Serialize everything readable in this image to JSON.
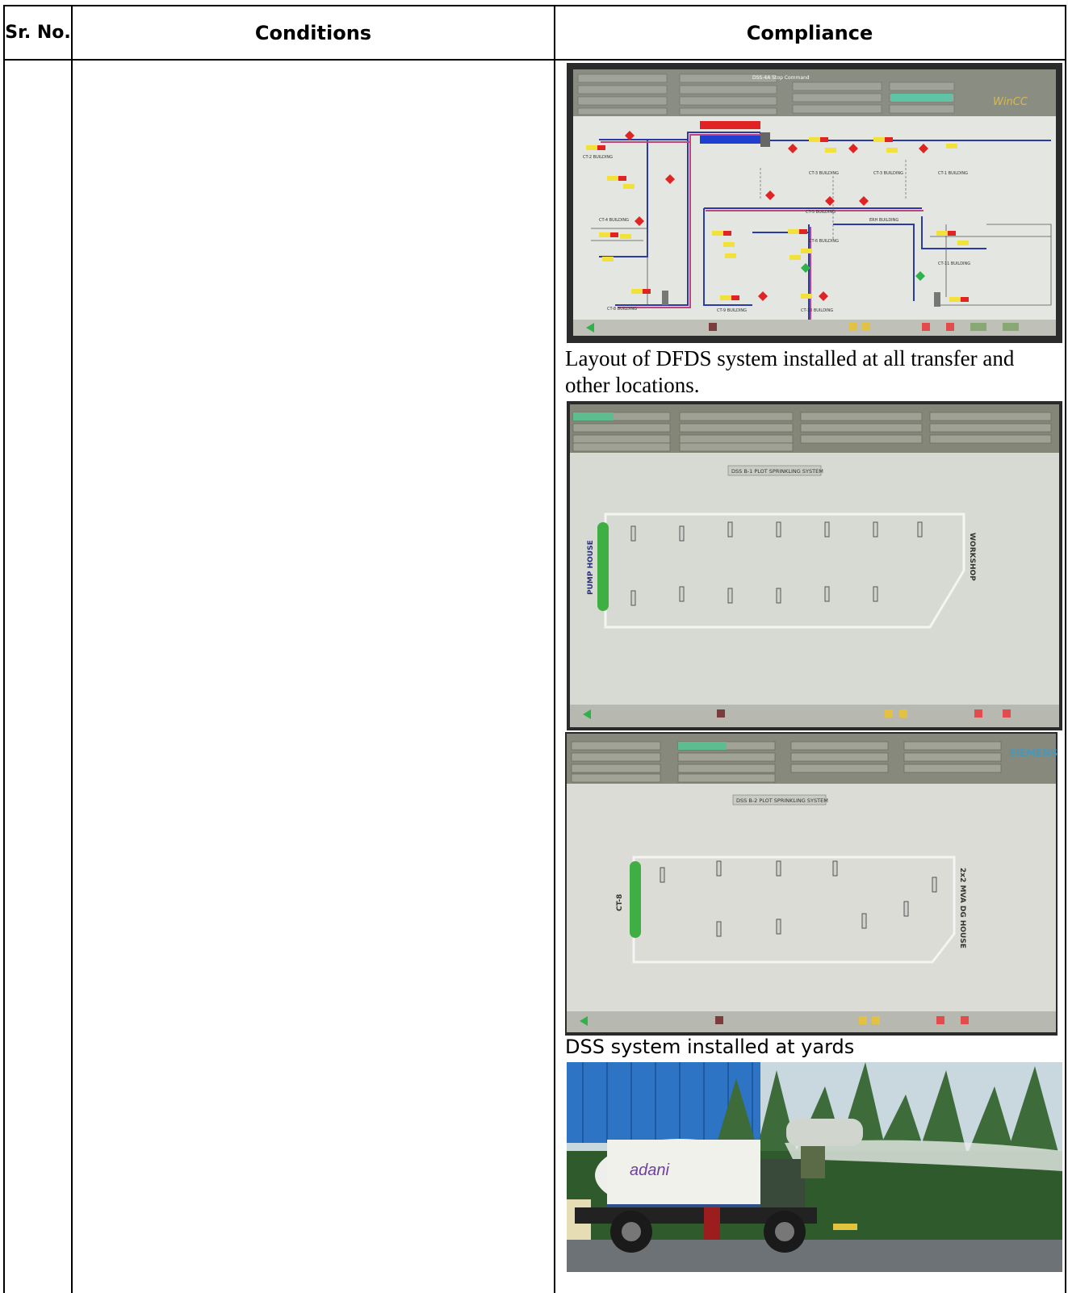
{
  "table": {
    "headers": {
      "sr_no": "Sr. No.",
      "conditions": "Conditions",
      "compliance": "Compliance"
    }
  },
  "compliance": {
    "caption_1": "Layout of DFDS system installed at all transfer and other locations.",
    "caption_2": "DSS system installed at yards",
    "photo_1": {
      "screen_title": "DSS-4A Stop Command",
      "brand": "WinCC",
      "building_labels": [
        "CT-2 BUILDING",
        "CT-3 BUILDING",
        "CT-1 BUILDING",
        "CT-4 BUILDING",
        "CT-5 BUILDING",
        "CT-6 BUILDING",
        "CT-8 BUILDING",
        "CT-9 BUILDING",
        "CT-11 BUILDING",
        "CT-10 BUILDING",
        "ERH BUILDING"
      ]
    },
    "photo_2": {
      "system_title": "DSS B-1 PLOT SPRINKLING SYSTEM",
      "left_label": "PUMP HOUSE",
      "right_label": "WORKSHOP"
    },
    "photo_3": {
      "system_title": "DSS B-2 PLOT SPRINKLING SYSTEM",
      "left_label": "CT-8",
      "right_label": "2x2 MVA DG HOUSE",
      "brand": "SIEMENS WinCC"
    },
    "photo_4": {
      "tanker_logo": "adani"
    }
  },
  "colors": {
    "border": "#000000",
    "screen_bg": "#e7e9e4",
    "pipe_blue": "#2a3aa6",
    "pipe_pink": "#c2447d",
    "valve_red": "#e02424",
    "tag_yellow": "#f2e13a",
    "header_bar": "#7f8275"
  }
}
